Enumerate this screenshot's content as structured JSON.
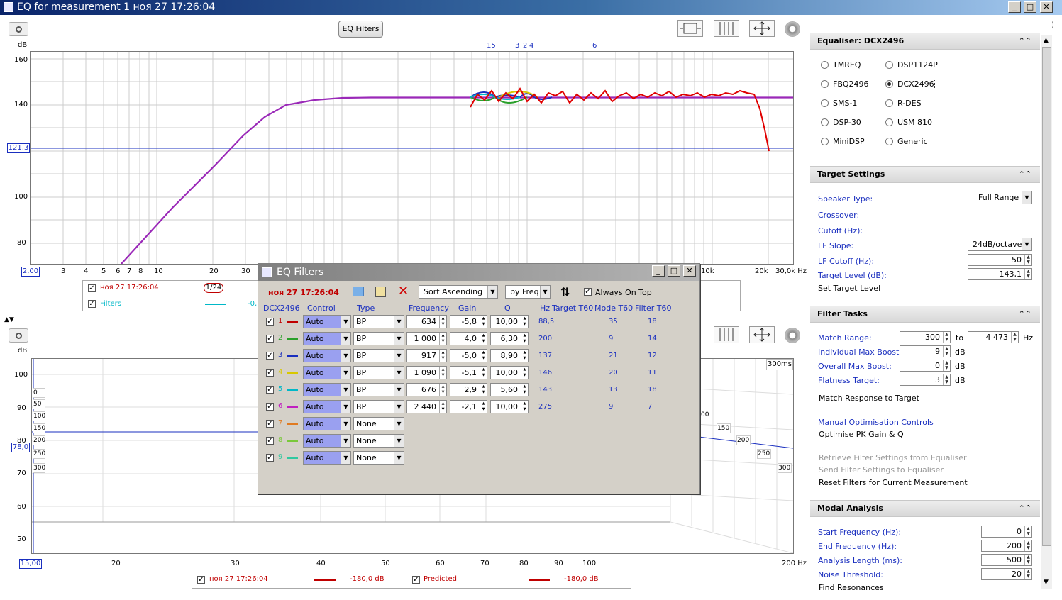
{
  "window": {
    "title": "EQ for measurement 1 ноя 27 17:26:04",
    "controls": [
      "_",
      "□",
      "✕"
    ]
  },
  "toolbar": {
    "eq_filters_button": "EQ Filters"
  },
  "top_chart": {
    "y_unit": "dB",
    "y_ticks": [
      "160",
      "140",
      "121,3",
      "100",
      "80"
    ],
    "x_ticks_left": [
      "2,00",
      "3",
      "4",
      "5",
      "6",
      "7",
      "8",
      "10",
      "20",
      "30"
    ],
    "x_ticks_right": [
      "10k",
      "20k",
      "30,0k Hz"
    ],
    "target_level_label": "121,3",
    "filter_markers": [
      "1",
      "5",
      "3",
      "2",
      "4",
      "6"
    ],
    "marker_positions": {
      "1": "15",
      "5": "",
      "3": "3",
      "2": "2",
      "4": "4",
      "6": "6"
    }
  },
  "top_legend": {
    "rows": [
      {
        "label": "ноя 27 17:26:04",
        "color": "#c00000",
        "smoothing": "1/24"
      },
      {
        "label": "Filters",
        "color": "#00b8c8",
        "value": "-0,"
      }
    ]
  },
  "bottom_chart": {
    "y_unit": "dB",
    "y_ticks": [
      "100",
      "90",
      "80",
      "78,0",
      "70",
      "60",
      "50"
    ],
    "x_ticks": [
      "15,00",
      "20",
      "30",
      "40",
      "50",
      "60",
      "70",
      "80",
      "90",
      "100",
      "200 Hz"
    ],
    "time_label": "300ms",
    "left_depth_labels": [
      "0",
      "50",
      "100",
      "150",
      "200",
      "250",
      "300"
    ],
    "right_depth_labels": [
      "00",
      "150",
      "200",
      "250",
      "300"
    ]
  },
  "bottom_legend": [
    {
      "label": "ноя 27 17:26:04",
      "value": "-180,0 dB"
    },
    {
      "label": "Predicted",
      "value": "-180,0 dB"
    }
  ],
  "eq_dialog": {
    "title": "EQ Filters",
    "measurement": "ноя 27 17:26:04",
    "sort": "Sort Ascending",
    "by": "by Freq",
    "always_on_top": "Always On Top",
    "headers": [
      "DCX2496",
      "Control",
      "Type",
      "Frequency",
      "Gain",
      "Q",
      "Hz",
      "Target T60",
      "Mode T60",
      "Filter T60"
    ],
    "rows": [
      {
        "num": "1",
        "color": "#c00000",
        "control": "Auto",
        "type": "BP",
        "freq": "634",
        "gain": "-5,8",
        "q": "10,00",
        "hz": "88,5",
        "mode": "35",
        "filter": "18"
      },
      {
        "num": "2",
        "color": "#2aa02a",
        "control": "Auto",
        "type": "BP",
        "freq": "1 000",
        "gain": "4,0",
        "q": "6,30",
        "hz": "200",
        "mode": "9",
        "filter": "14"
      },
      {
        "num": "3",
        "color": "#1a2fbf",
        "control": "Auto",
        "type": "BP",
        "freq": "917",
        "gain": "-5,0",
        "q": "8,90",
        "hz": "137",
        "mode": "21",
        "filter": "12"
      },
      {
        "num": "4",
        "color": "#d8c800",
        "control": "Auto",
        "type": "BP",
        "freq": "1 090",
        "gain": "-5,1",
        "q": "10,00",
        "hz": "146",
        "mode": "20",
        "filter": "11"
      },
      {
        "num": "5",
        "color": "#00b8c8",
        "control": "Auto",
        "type": "BP",
        "freq": "676",
        "gain": "2,9",
        "q": "5,60",
        "hz": "143",
        "mode": "13",
        "filter": "18"
      },
      {
        "num": "6",
        "color": "#c020c0",
        "control": "Auto",
        "type": "BP",
        "freq": "2 440",
        "gain": "-2,1",
        "q": "10,00",
        "hz": "275",
        "mode": "9",
        "filter": "7"
      },
      {
        "num": "7",
        "color": "#e07a20",
        "control": "Auto",
        "type": "None",
        "freq": "",
        "gain": "",
        "q": "",
        "hz": "",
        "mode": "",
        "filter": ""
      },
      {
        "num": "8",
        "color": "#7ac83a",
        "control": "Auto",
        "type": "None",
        "freq": "",
        "gain": "",
        "q": "",
        "hz": "",
        "mode": "",
        "filter": ""
      },
      {
        "num": "9",
        "color": "#30c8a0",
        "control": "Auto",
        "type": "None",
        "freq": "",
        "gain": "",
        "q": "",
        "hz": "",
        "mode": "",
        "filter": ""
      }
    ]
  },
  "equaliser": {
    "title": "Equaliser: DCX2496",
    "options": [
      {
        "label": "TMREQ",
        "selected": false
      },
      {
        "label": "DSP1124P",
        "selected": false
      },
      {
        "label": "FBQ2496",
        "selected": false
      },
      {
        "label": "DCX2496",
        "selected": true
      },
      {
        "label": "SMS-1",
        "selected": false
      },
      {
        "label": "R-DES",
        "selected": false
      },
      {
        "label": "DSP-30",
        "selected": false
      },
      {
        "label": "USM 810",
        "selected": false
      },
      {
        "label": "MiniDSP",
        "selected": false
      },
      {
        "label": "Generic",
        "selected": false
      }
    ]
  },
  "target_settings": {
    "title": "Target Settings",
    "speaker_type_label": "Speaker Type:",
    "speaker_type": "Full Range",
    "crossover_label": "Crossover:",
    "cutoff_label": "Cutoff (Hz):",
    "lf_slope_label": "LF Slope:",
    "lf_slope": "24dB/octave",
    "lf_cutoff_label": "LF Cutoff (Hz):",
    "lf_cutoff": "50",
    "target_level_label": "Target Level (dB):",
    "target_level": "143,1",
    "set_target_level": "Set Target Level"
  },
  "filter_tasks": {
    "title": "Filter Tasks",
    "match_range_label": "Match Range:",
    "match_from": "300",
    "to": "to",
    "match_to": "4 473",
    "hz": "Hz",
    "ind_boost_label": "Individual Max Boost:",
    "ind_boost": "9",
    "overall_boost_label": "Overall Max Boost:",
    "overall_boost": "0",
    "flatness_label": "Flatness Target:",
    "flatness": "3",
    "db": "dB",
    "match_response": "Match Response to Target",
    "manual_opt": "Manual Optimisation Controls",
    "optimise": "Optimise PK Gain & Q",
    "retrieve": "Retrieve Filter Settings from Equaliser",
    "send": "Send Filter Settings to Equaliser",
    "reset": "Reset Filters for Current Measurement"
  },
  "modal_analysis": {
    "title": "Modal Analysis",
    "start_label": "Start Frequency (Hz):",
    "start": "0",
    "end_label": "End Frequency (Hz):",
    "end": "200",
    "length_label": "Analysis Length (ms):",
    "length": "500",
    "noise_label": "Noise Threshold:",
    "noise": "20",
    "find": "Find Resonances"
  },
  "colors": {
    "measurement": "#e00000",
    "predicted": "#9a28b8",
    "target_line": "#1a2fbf",
    "accent_blue": "#1a2fbf"
  }
}
